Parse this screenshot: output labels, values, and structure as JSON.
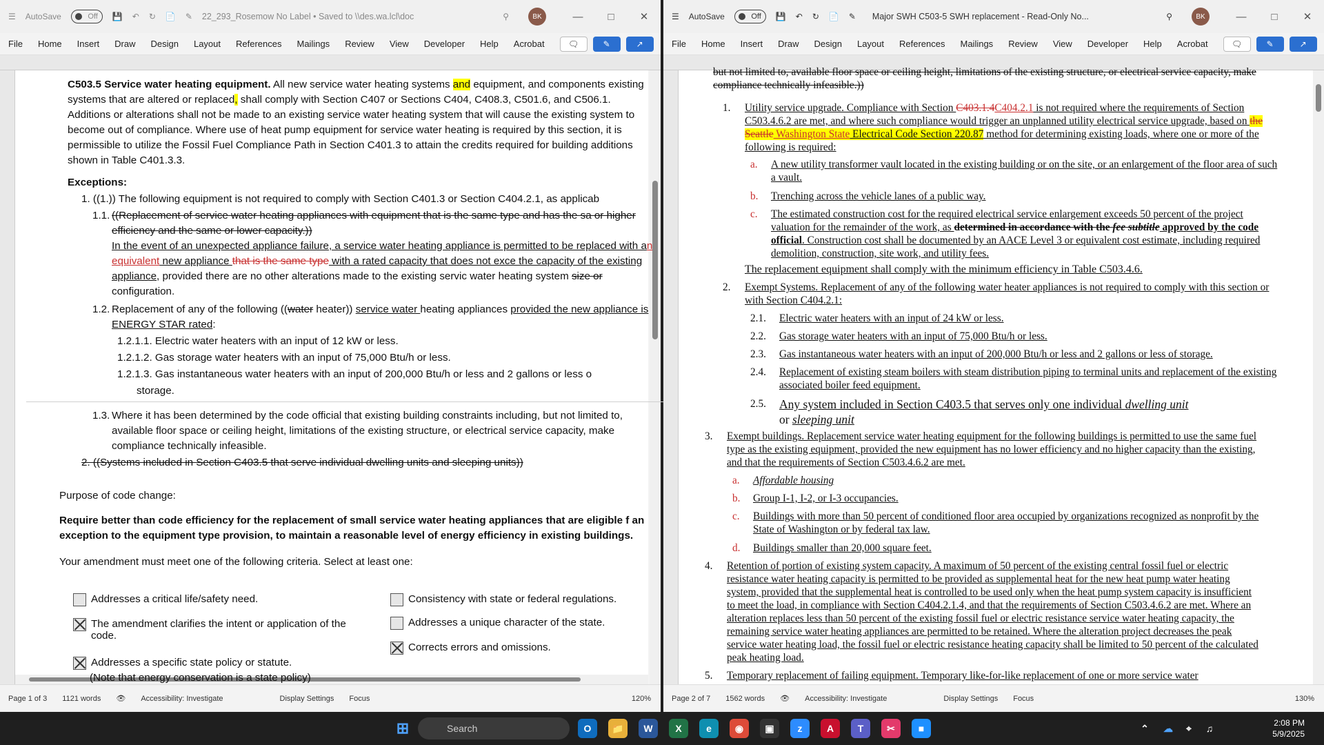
{
  "left_window": {
    "autosave_label": "AutoSave",
    "autosave_state": "Off",
    "doc_title": "22_293_Rosemow  No Label • Saved to \\\\des.wa.lcl\\doc",
    "avatar": "BK",
    "menu": [
      "File",
      "Home",
      "Insert",
      "Draw",
      "Design",
      "Layout",
      "References",
      "Mailings",
      "Review",
      "View",
      "Developer",
      "Help",
      "Acrobat"
    ],
    "status": {
      "page": "Page 1 of 3",
      "words": "1121 words",
      "accessibility": "Accessibility: Investigate",
      "display": "Display Settings",
      "focus": "Focus",
      "zoom": "120%"
    },
    "doc": {
      "p1_heading": "C503.5 Service water heating equipment.",
      "p1_a": " All new service water heating systems ",
      "p1_hl": "and",
      "p1_b": " equipment, and components existing systems that are altered or replaced",
      "p1_hl2": ",",
      "p1_c": " shall comply with Section C407 or Sections C404, C408.3, C501.6, and C506.1. Additions or alterations shall not be made to an existing service water heating system that will cause the existing system to become out of compliance. Where use of heat pump equipment for service water heating is required by this section, it is permissible to utilize the Fossil Fuel Compliance Path in Section C401.3 to attain the credits required for building additions shown in Table C401.3.3.",
      "exceptions": "Exceptions:",
      "ex1": "1.   ((1.)) The following equipment is not required to comply with Section C401.3 or Section C404.2.1, as applicab",
      "ex11_num": "1.1.",
      "ex11_strike": "((Replacement of service water heating appliances with equipment that is the same type and has the sa or higher efficiency and the same or lower capacity.))",
      "ex11_new_a": "In the event of an unexpected appliance failure, a service water heating appliance is permitted to be replaced with a",
      "ex11_new_red": "n equivalent",
      "ex11_new_b": " new appliance ",
      "ex11_new_strike": "that is the same type",
      "ex11_new_c": " with a rated capacity that does not exce the capacity of the existing appliance",
      "ex11_new_d": ", provided there are no other alterations made to the existing servic water heating system ",
      "ex11_new_strike2": "size or",
      "ex11_new_e": " configuration.",
      "ex12_num": "1.2.",
      "ex12_a": "Replacement of any of the following ((",
      "ex12_strike": "water",
      "ex12_b": " heater)) ",
      "ex12_und": "service water ",
      "ex12_c": "heating appliances ",
      "ex12_und2": "provided the new appliance is ENERGY STAR rated",
      "ex12_d": ":",
      "ex121": "1.2.1.1.    Electric water heaters with an input of 12 kW or less.",
      "ex122": "1.2.1.2.    Gas storage water heaters with an input of 75,000 Btu/h or less.",
      "ex123": "1.2.1.3.    Gas instantaneous water heaters with an input of 200,000 Btu/h or less and 2 gallons or less o",
      "ex123b": "storage.",
      "ex13_num": "1.3.",
      "ex13": "Where it has been determined by the code official that existing building constraints including, but not limited to, available floor space or ceiling height, limitations of the existing structure, or electrical service capacity, make compliance technically infeasible.",
      "ex2": "2.   ((Systems included in Section C403.5 that serve individual dwelling units and sleeping units))",
      "purpose": "Purpose of code change:",
      "purpose_text": "Require better than code efficiency for the replacement of small service water heating appliances that are eligible f an exception to the equipment type provision, to maintain a reasonable level of energy efficiency in existing buildings.",
      "criteria": "Your amendment must meet one of the following criteria. Select at least one:",
      "checkboxes": [
        {
          "label": "Addresses a critical life/safety need.",
          "checked": false
        },
        {
          "label": "Consistency with state or federal regulations.",
          "checked": false
        },
        {
          "label": "The amendment clarifies the intent or application of the code.",
          "checked": true
        },
        {
          "label": "Addresses a unique character of the state.",
          "checked": false
        },
        {
          "label": "Addresses a specific state policy or statute.",
          "checked": true
        },
        {
          "label": "Corrects errors and omissions.",
          "checked": true
        }
      ],
      "note": "(Note that energy conservation is a state policy)"
    }
  },
  "right_window": {
    "autosave_label": "AutoSave",
    "autosave_state": "Off",
    "doc_title": "Major SWH C503-5 SWH replacement - Read-Only  No...",
    "avatar": "BK",
    "menu": [
      "File",
      "Home",
      "Insert",
      "Draw",
      "Design",
      "Layout",
      "References",
      "Mailings",
      "Review",
      "View",
      "Developer",
      "Help",
      "Acrobat"
    ],
    "status": {
      "page": "Page 2 of 7",
      "words": "1562 words",
      "accessibility": "Accessibility: Investigate",
      "display": "Display Settings",
      "focus": "Focus",
      "zoom": "130%"
    },
    "doc": {
      "top_strike": "but not limited to, available floor space or ceiling height, limitations of the existing structure, or electrical service capacity, make compliance technically infeasible.))",
      "i1_num": "1.",
      "i1_a": "Utility service upgrade. Compliance with Section ",
      "i1_strike": "C403.1.4",
      "i1_red": "C404.2.1",
      "i1_b": " is not required where the requirements of Section C503.4.6.2 are met, and where such compliance would trigger an unplanned utility electrical service upgrade, based on ",
      "i1_hl_strike": "the Seattle",
      "i1_hl": " Washington State",
      "i1_hl2": " Electrical Code Section 220.87",
      "i1_c": " method for determining existing loads, where one or more of the following is required:",
      "a_label": "a.",
      "a_text": "A new utility transformer vault located in the existing building or on the site, or an enlargement of the floor area of such a vault.",
      "b_label": "b.",
      "b_text": "Trenching across the vehicle lanes of a public way.",
      "c_label": "c.",
      "c_text_a": "The estimated construction cost for the required electrical service enlargement exceeds 50 percent of the project valuation for the remainder of the work, as ",
      "c_strike": "determined in accordance with the ",
      "c_strike_i": "fee subtitle",
      "c_text_b": " approved by the code official",
      "c_text_c": ". Construction cost shall be documented by an AACE Level 3 or equivalent cost estimate, including required demolition, construction, site work, and utility fees.",
      "replace_line": "The replacement equipment shall comply with the minimum efficiency in Table C503.4.6.",
      "i2_num": "2.",
      "i2": "Exempt Systems. Replacement of any of the following water heater appliances is not required to comply with this section or with Section C404.2.1:",
      "i21": "2.1.",
      "i21t": "Electric water heaters with an input of 24 kW or less.",
      "i22": "2.2.",
      "i22t": "Gas storage water heaters with an input of 75,000 Btu/h or less.",
      "i23": "2.3.",
      "i23t": "Gas instantaneous water heaters with an input of 200,000 Btu/h or less and 2 gallons or less of storage.",
      "i24": "2.4.",
      "i24t": "Replacement of existing steam boilers with steam distribution piping to terminal units and replacement of the existing associated boiler feed equipment.",
      "i25": "2.5.",
      "i25a": "Any system included in Section C403.5 that serves only one individual ",
      "i25i": "dwelling unit",
      "i25b": " or ",
      "i25i2": "sleeping unit",
      "i3_num": "3.",
      "i3": "Exempt buildings. Replacement service water heating equipment for the following buildings is permitted to use the same fuel type as the existing equipment, provided the new equipment has no lower efficiency and no higher capacity than the existing, and that the requirements of Section C503.4.6.2 are met.",
      "ba": "a.",
      "bat": "Affordable housing",
      "bb": "b.",
      "bbt": "Group I-1, I-2, or I-3 occupancies.",
      "bc": "c.",
      "bct": "Buildings with more than 50 percent of conditioned floor area occupied by organizations recognized as nonprofit by the State of Washington or by federal tax law.",
      "bd": "d.",
      "bdt": "Buildings smaller than 20,000 square feet.",
      "i4_num": "4.",
      "i4": "Retention of portion of existing system capacity. A maximum of 50 percent of the existing central fossil fuel or electric resistance water heating capacity is permitted to be provided as supplemental heat for the new heat pump water heating system, provided that the supplemental heat is controlled to be used only when the heat pump system capacity is insufficient to meet the load, in compliance with Section C404.2.1.4, and that the requirements of Section C503.4.6.2 are met. Where an alteration replaces less than 50 percent of the existing fossil fuel or electric resistance service water heating capacity, the remaining service water heating appliances are permitted to be retained. Where the alteration project decreases the peak service water heating load, the fossil fuel or electric resistance heating capacity shall be limited to 50 percent of the calculated peak heating load.",
      "i5_num": "5.",
      "i5": "Temporary replacement of failing equipment. Temporary like-for-like replacement of one or more service water"
    }
  },
  "taskbar": {
    "search": "Search",
    "time": "2:08 PM",
    "date": "5/9/2025"
  }
}
